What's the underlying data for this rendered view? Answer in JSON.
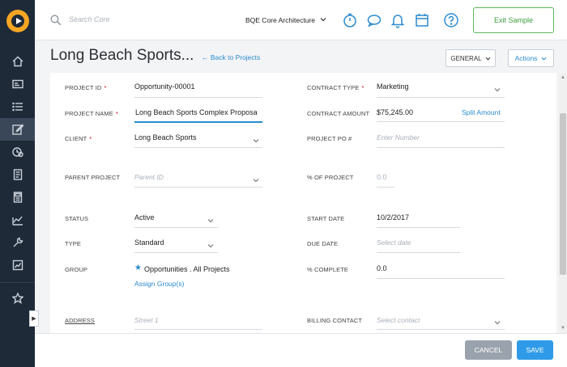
{
  "search": {
    "placeholder": "Search Core"
  },
  "topbar": {
    "company": "BQE Core Architecture",
    "exit_label": "Exit Sample",
    "icons": [
      "timer-icon",
      "chat-icon",
      "bell-icon",
      "calendar-icon",
      "help-icon"
    ]
  },
  "sidebar": {
    "items": [
      "home-icon",
      "id-card-icon",
      "list-icon",
      "edit-icon",
      "money-clock-icon",
      "document-icon",
      "calculator-icon",
      "chart-icon",
      "wrench-icon",
      "report-icon",
      "star-icon"
    ],
    "active": "edit-icon"
  },
  "header": {
    "title": "Long Beach Sports...",
    "back_label": "← Back to Projects",
    "general_label": "GENERAL",
    "actions_label": "Actions"
  },
  "form": {
    "project_id_label": "PROJECT ID",
    "project_id_value": "Opportunity-00001",
    "project_name_label": "PROJECT NAME",
    "project_name_value": "Long Beach Sports Complex Proposa",
    "client_label": "CLIENT",
    "client_value": "Long Beach Sports",
    "parent_project_label": "PARENT PROJECT",
    "parent_project_placeholder": "Parent ID",
    "status_label": "STATUS",
    "status_value": "Active",
    "type_label": "TYPE",
    "type_value": "Standard",
    "group_label": "GROUP",
    "group_value": "Opportunities . All Projects",
    "assign_group_label": "Assign Group(s)",
    "address_label": "ADDRESS",
    "address_placeholder": "Street 1",
    "contract_type_label": "CONTRACT TYPE",
    "contract_type_value": "Marketing",
    "contract_amount_label": "CONTRACT AMOUNT",
    "contract_amount_value": "$75,245.00",
    "split_amount_label": "Split Amount",
    "project_po_label": "PROJECT PO #",
    "project_po_placeholder": "Enter Number",
    "pct_of_project_label": "% OF PROJECT",
    "pct_of_project_value": "0.0",
    "start_date_label": "START DATE",
    "start_date_value": "10/2/2017",
    "due_date_label": "DUE DATE",
    "due_date_placeholder": "Select date",
    "pct_complete_label": "% COMPLETE",
    "pct_complete_value": "0.0",
    "billing_contact_label": "BILLING CONTACT",
    "billing_contact_placeholder": "Select contact"
  },
  "footer": {
    "cancel_label": "CANCEL",
    "save_label": "SAVE"
  },
  "colors": {
    "sidebar": "#1e2a38",
    "accent": "#2a8bd1",
    "exit_green": "#5cb85c",
    "save_blue": "#2f9be8",
    "cancel_gray": "#9aa3ad"
  }
}
